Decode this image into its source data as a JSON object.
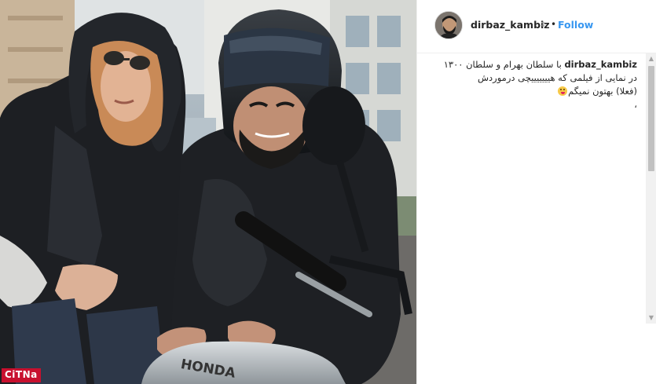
{
  "post": {
    "username": "dirbaz_kambiz",
    "verified_glyph": "⇕",
    "separator": "•",
    "follow_label": "Follow",
    "caption": {
      "user": "dirbaz_kambiz",
      "line1": "با سلطان بهرام و سلطان ۱۳۰۰",
      "line2": "در نمایی از فیلمی که هیییییییچی درموردش",
      "line3": "(فعلا) بهتون نمیگم",
      "line4": "،"
    }
  },
  "photo": {
    "brand_text": "HONDA",
    "watermark": "CiTNa"
  },
  "colors": {
    "follow": "#3897f0",
    "watermark_bg": "#c8102e",
    "text": "#262626"
  },
  "icons": {
    "avatar": "profile-avatar",
    "verify": "verified-badge-icon",
    "emoji": "tongue-emoji-icon"
  }
}
